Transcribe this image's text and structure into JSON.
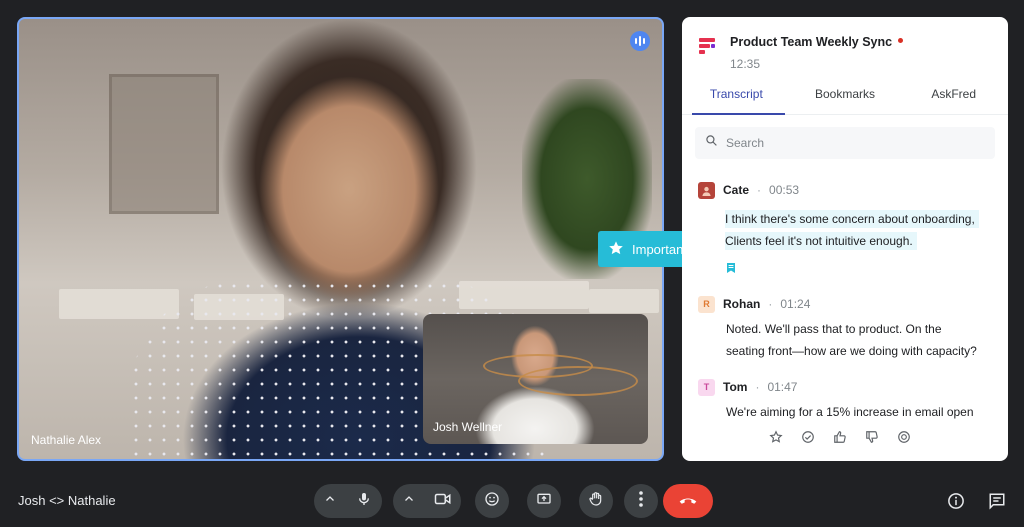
{
  "main_video": {
    "participant_name": "Nathalie Alex",
    "pip_participant_name": "Josh Wellner"
  },
  "tag": {
    "label": "Important"
  },
  "panel": {
    "title": "Product Team Weekly Sync",
    "time": "12:35",
    "tabs": [
      {
        "label": "Transcript",
        "active": true
      },
      {
        "label": "Bookmarks",
        "active": false
      },
      {
        "label": "AskFred",
        "active": false
      }
    ],
    "search_placeholder": "Search",
    "entries": [
      {
        "speaker": "Cate",
        "avatar_initial": "",
        "avatar_color": "#b5443a",
        "separator": "·",
        "timestamp": "00:53",
        "lines": [
          "I think there's some concern about onboarding,",
          "Clients feel it's not intuitive enough."
        ],
        "highlighted": true
      },
      {
        "speaker": "Rohan",
        "avatar_initial": "R",
        "avatar_color": "#fbe3cf",
        "separator": "·",
        "timestamp": "01:24",
        "lines": [
          "Noted. We'll pass that to product. On the",
          "seating front—how are we doing with capacity?"
        ],
        "highlighted": false
      },
      {
        "speaker": "Tom",
        "avatar_initial": "T",
        "avatar_color": "#f9d8ef",
        "separator": "·",
        "timestamp": "01:47",
        "lines": [
          "We're aiming for a 15% increase in email open"
        ],
        "highlighted": false
      }
    ],
    "reactions": [
      "star-icon",
      "check-circle-icon",
      "thumbs-up-icon",
      "thumbs-down-icon",
      "target-icon"
    ]
  },
  "bottom_bar": {
    "meeting_name": "Josh <> Nathalie"
  },
  "colors": {
    "accent": "#3949ab",
    "tag": "#26bcd7",
    "end_call": "#ea4335",
    "active_border": "#7aa7f5"
  }
}
